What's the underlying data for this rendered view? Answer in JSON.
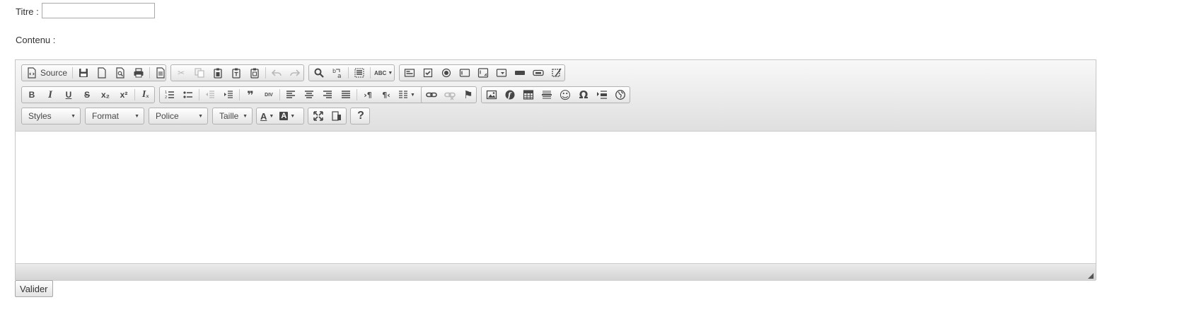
{
  "form": {
    "title_label": "Titre :",
    "title_value": "",
    "content_label": "Contenu :",
    "submit_label": "Valider"
  },
  "toolbar": {
    "source_label": "Source",
    "combos": {
      "styles": "Styles",
      "format": "Format",
      "font": "Police",
      "size": "Taille"
    },
    "glyphs": {
      "cut": "✂",
      "find": "⌕",
      "spellcheck": "ABC",
      "bold": "B",
      "italic": "I",
      "underline": "U",
      "strike": "S",
      "subscript": "x₂",
      "superscript": "x²",
      "remove_format": "Iₓ",
      "blockquote": "❞",
      "creatediv": "DIV",
      "ltr": "›¶",
      "rtl": "¶‹",
      "anchor": "⚑",
      "flash": "ƒ",
      "smiley": "☺",
      "special_char": "Ω",
      "text_color": "A",
      "bg_color": "A",
      "about": "?"
    }
  }
}
